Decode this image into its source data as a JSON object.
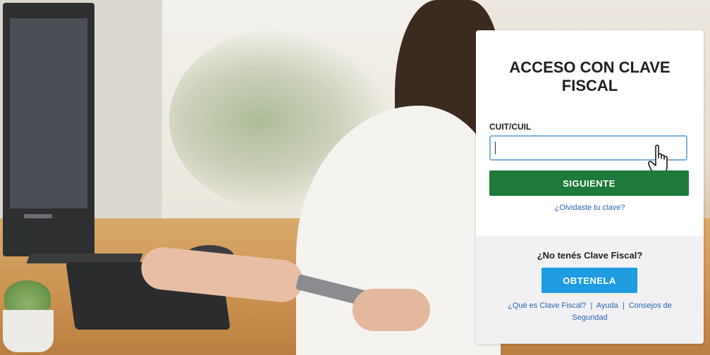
{
  "login": {
    "title": "ACCESO CON CLAVE FISCAL",
    "field_label": "CUIT/CUIL",
    "field_value": "",
    "next_button": "SIGUIENTE",
    "forgot_link": "¿Olvidaste tu clave?"
  },
  "register": {
    "prompt": "¿No tenés Clave Fiscal?",
    "get_button": "OBTENELA",
    "links": {
      "what_is": "¿Qué es Clave Fiscal?",
      "help": "Ayuda",
      "security": "Consejos de Seguridad",
      "separator": "|"
    }
  },
  "colors": {
    "next_button": "#1d7a3a",
    "get_button": "#1f9ce0",
    "link": "#2a63b0",
    "input_border": "#7eb2e0"
  },
  "icons": {
    "cursor": "pointer-hand-icon"
  }
}
